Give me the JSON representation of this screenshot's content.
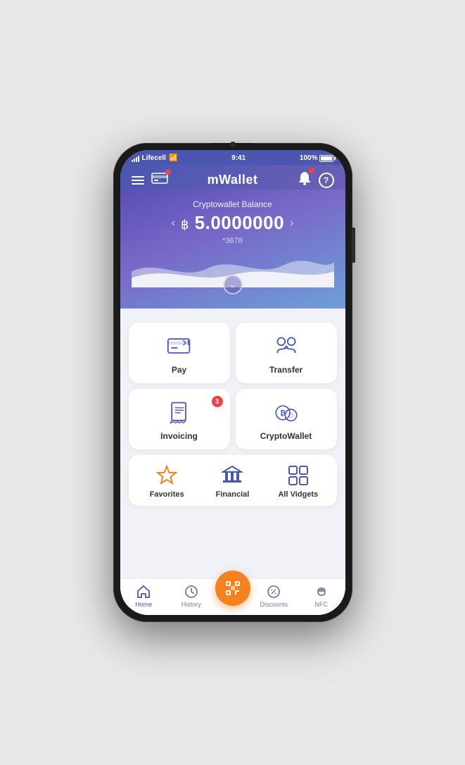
{
  "status_bar": {
    "carrier": "Lifecell",
    "time": "9:41",
    "battery": "100%"
  },
  "header": {
    "title": "mWallet",
    "help_label": "?"
  },
  "balance": {
    "label": "Cryptowallet Balance",
    "currency_symbol": "฿",
    "amount": "5.0000000",
    "account_suffix": "*3678"
  },
  "grid": {
    "row1": [
      {
        "id": "pay",
        "label": "Pay",
        "badge": null
      },
      {
        "id": "transfer",
        "label": "Transfer",
        "badge": null
      }
    ],
    "row2": [
      {
        "id": "invoicing",
        "label": "Invoicing",
        "badge": "3"
      },
      {
        "id": "cryptowallet",
        "label": "CryptoWallet",
        "badge": null
      }
    ]
  },
  "widgets": [
    {
      "id": "favorites",
      "label": "Favorites",
      "icon_type": "star",
      "color": "orange"
    },
    {
      "id": "financial",
      "label": "Financial",
      "icon_type": "bank",
      "color": "blue"
    },
    {
      "id": "all_vidgets",
      "label": "All Vidgets",
      "icon_type": "grid",
      "color": "blue"
    }
  ],
  "bottom_nav": [
    {
      "id": "home",
      "label": "Home",
      "icon": "home",
      "active": true
    },
    {
      "id": "history",
      "label": "History",
      "icon": "clock",
      "active": false
    },
    {
      "id": "scan",
      "label": "",
      "icon": "scan",
      "active": false,
      "is_fab": true
    },
    {
      "id": "discounts",
      "label": "Discounts",
      "icon": "tag",
      "active": false
    },
    {
      "id": "nfc",
      "label": "NFC",
      "icon": "nfc",
      "active": false
    }
  ]
}
